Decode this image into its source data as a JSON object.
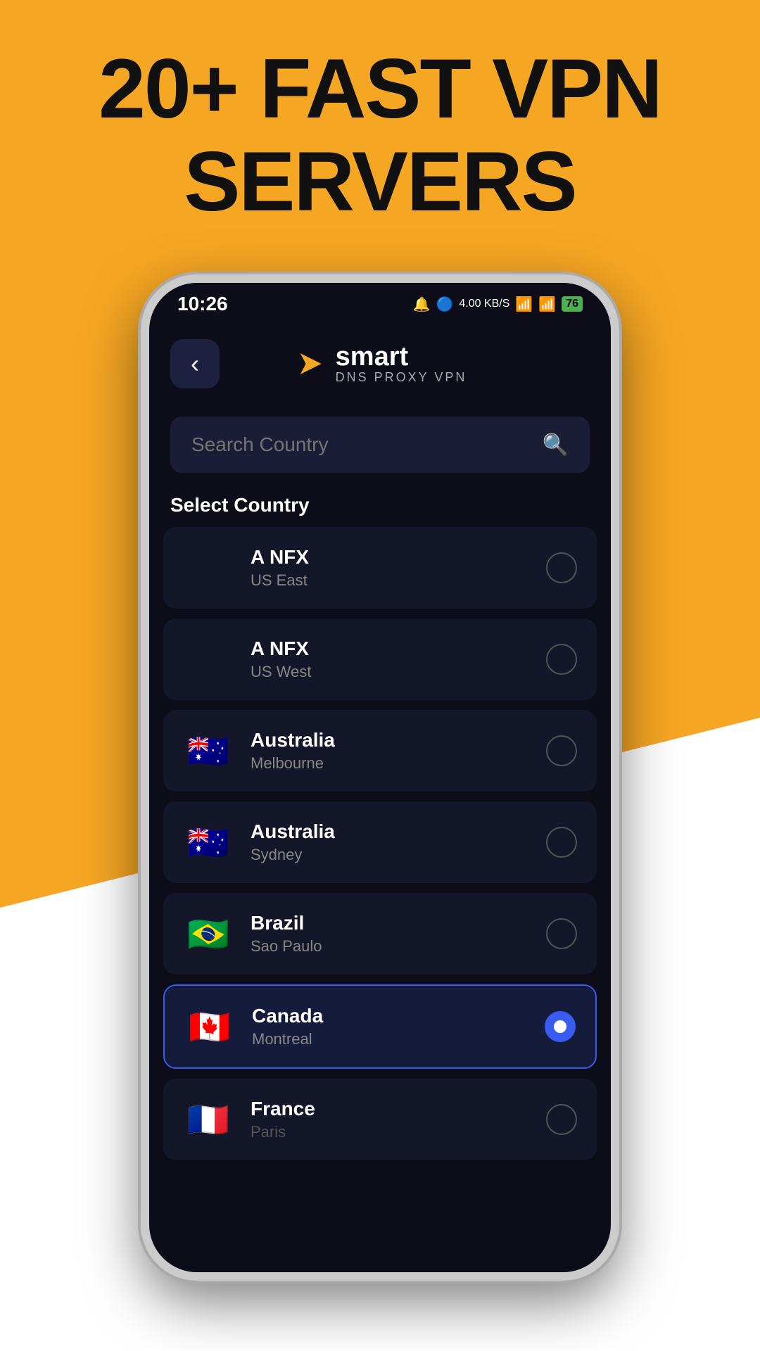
{
  "background": {
    "headline_line1": "20+ FAST VPN",
    "headline_line2": "SERVERS"
  },
  "status_bar": {
    "time": "10:26",
    "data_speed": "4.00 KB/S",
    "battery": "76"
  },
  "header": {
    "back_label": "‹",
    "logo_main": "smart",
    "logo_sub": "DNS PROXY VPN"
  },
  "search": {
    "placeholder": "Search Country"
  },
  "section": {
    "label": "Select Country"
  },
  "countries": [
    {
      "id": "anfx-east",
      "name": "A NFX",
      "city": "US East",
      "flag": "",
      "selected": false
    },
    {
      "id": "anfx-west",
      "name": "A NFX",
      "city": "US West",
      "flag": "",
      "selected": false
    },
    {
      "id": "au-melbourne",
      "name": "Australia",
      "city": "Melbourne",
      "flag": "🇦🇺",
      "selected": false
    },
    {
      "id": "au-sydney",
      "name": "Australia",
      "city": "Sydney",
      "flag": "🇦🇺",
      "selected": false
    },
    {
      "id": "br-saopaulo",
      "name": "Brazil",
      "city": "Sao Paulo",
      "flag": "🇧🇷",
      "selected": false
    },
    {
      "id": "ca-montreal",
      "name": "Canada",
      "city": "Montreal",
      "flag": "🇨🇦",
      "selected": true
    },
    {
      "id": "fr-paris",
      "name": "France",
      "city": "Paris",
      "flag": "🇫🇷",
      "selected": false
    }
  ]
}
